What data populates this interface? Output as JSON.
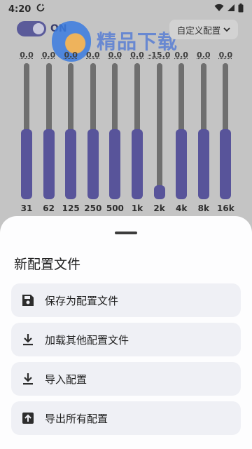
{
  "status_bar": {
    "time": "4:20",
    "sync_icon": "sync-icon"
  },
  "toggle": {
    "label": "ON",
    "state": "on"
  },
  "watermark": {
    "text": "精品下载"
  },
  "preset": {
    "label": "自定义配置"
  },
  "equalizer": {
    "bands": [
      {
        "freq": "31",
        "value": "0.0",
        "level": 0.5
      },
      {
        "freq": "62",
        "value": "0.0",
        "level": 0.5
      },
      {
        "freq": "125",
        "value": "0.0",
        "level": 0.5
      },
      {
        "freq": "250",
        "value": "0.0",
        "level": 0.5
      },
      {
        "freq": "500",
        "value": "0.0",
        "level": 0.5
      },
      {
        "freq": "1k",
        "value": "0.0",
        "level": 0.5
      },
      {
        "freq": "2k",
        "value": "-15.0",
        "level": 0.0
      },
      {
        "freq": "4k",
        "value": "0.0",
        "level": 0.5
      },
      {
        "freq": "8k",
        "value": "0.0",
        "level": 0.5
      },
      {
        "freq": "16k",
        "value": "0.0",
        "level": 0.5
      }
    ],
    "accent": "#58549a"
  },
  "sheet": {
    "title": "新配置文件",
    "items": [
      {
        "label": "保存为配置文件",
        "icon": "save-icon"
      },
      {
        "label": "加载其他配置文件",
        "icon": "download-icon"
      },
      {
        "label": "导入配置",
        "icon": "download-icon"
      },
      {
        "label": "导出所有配置",
        "icon": "upload-icon"
      }
    ]
  }
}
